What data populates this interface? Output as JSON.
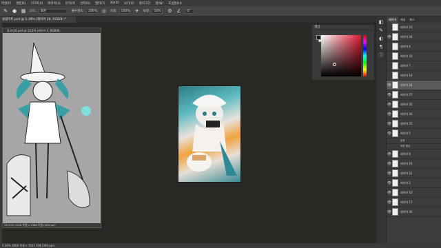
{
  "menu": [
    "파일(F)",
    "편집(E)",
    "이미지(I)",
    "레이어(L)",
    "문자(Y)",
    "선택(S)",
    "필터(T)",
    "3D(D)",
    "보기(V)",
    "플러그인",
    "창(W)",
    "도움말(H)"
  ],
  "options": {
    "mode_label": "모드:",
    "mode_value": "표준",
    "opacity_label": "불투명도:",
    "opacity_value": "100%",
    "flow_label": "흐름:",
    "flow_value": "100%",
    "smooth_label": "보정:",
    "smooth_value": "10%",
    "angle_value": "0°"
  },
  "doc_tab": "클립아트.psd @ 5.39% (레이어 28, RGB/8) *",
  "subwindow": {
    "title": "참고자료.psd @ 33.3% (레이어 1, RGB/8)",
    "status": "33.33%   2220 픽셀 x 3386 픽셀 (300 ppi)"
  },
  "status_bar": "5.39%   3000 픽셀 x 7011 픽셀 (300 ppi)",
  "color_panel": {
    "title": "색상",
    "fg": "#1a1a1a",
    "bg": "#ffffff",
    "hue": "#e0192f"
  },
  "layers_panel": {
    "tabs": [
      "레이어",
      "채널",
      "패스"
    ],
    "rows": [
      {
        "name": "레이어 24",
        "eye": ""
      },
      {
        "name": "레이어 28",
        "eye": "👁"
      },
      {
        "name": "레이어 4",
        "eye": ""
      },
      {
        "name": "레이어 10",
        "eye": ""
      },
      {
        "name": "레이어 7",
        "eye": ""
      },
      {
        "name": "레이어 14",
        "eye": ""
      },
      {
        "name": "레이어 18",
        "eye": "👁"
      },
      {
        "name": "레이어 27",
        "eye": "👁"
      },
      {
        "name": "레이어 20",
        "eye": "👁"
      },
      {
        "name": "레이어 26",
        "eye": "👁"
      },
      {
        "name": "레이어 25",
        "eye": "👁"
      },
      {
        "name": "레이어 5",
        "eye": "👁"
      }
    ],
    "effect_label": "효과",
    "effect_item": "외부 광선",
    "rows2": [
      {
        "name": "레이어 8",
        "eye": "👁"
      },
      {
        "name": "레이어 19",
        "eye": "👁"
      },
      {
        "name": "레이어 22",
        "eye": "👁"
      },
      {
        "name": "레이어 2",
        "eye": "👁"
      },
      {
        "name": "레이어 16",
        "eye": "👁"
      },
      {
        "name": "레이어 17",
        "eye": "👁"
      },
      {
        "name": "레이어 30",
        "eye": "👁"
      }
    ]
  }
}
